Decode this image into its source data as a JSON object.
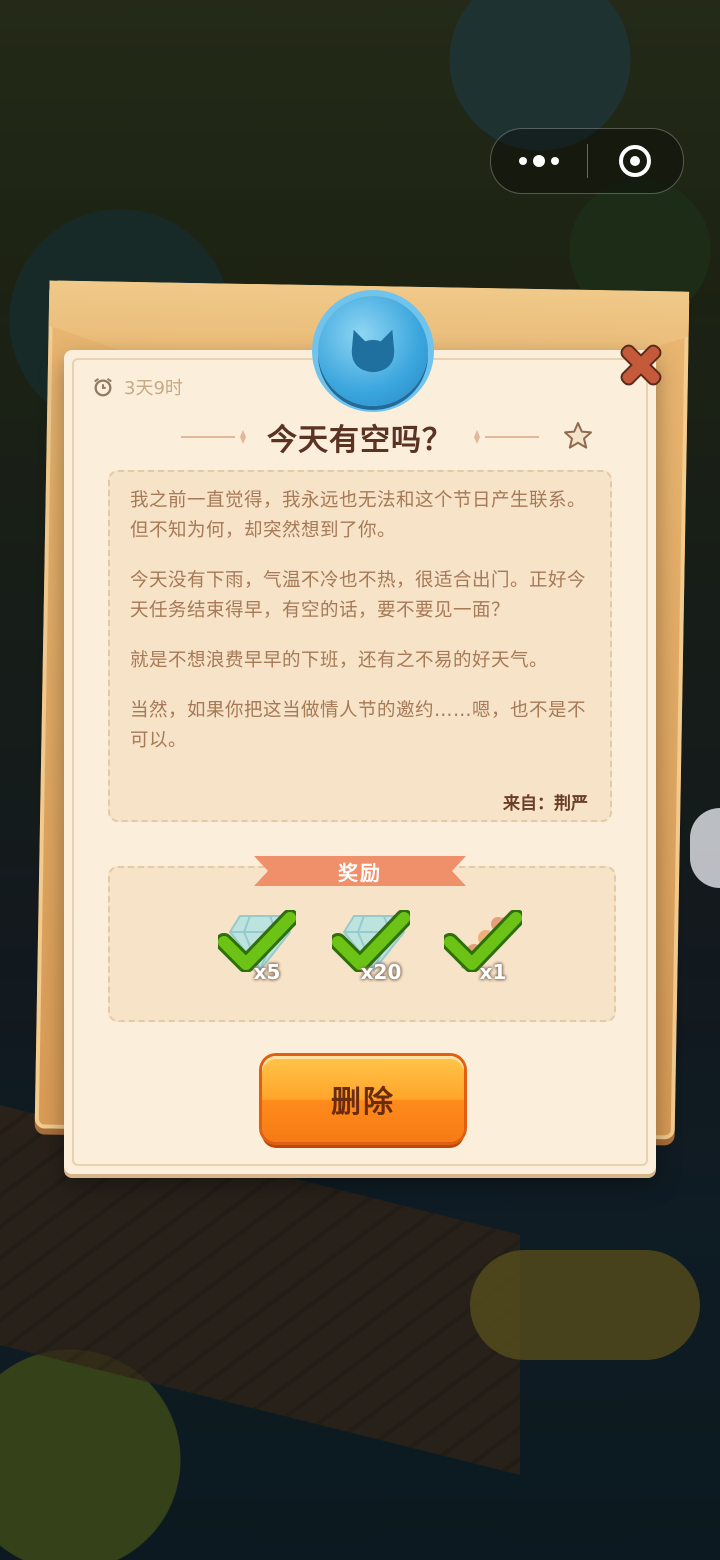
{
  "timer": {
    "text": "3天9时"
  },
  "letter": {
    "title": "今天有空吗？",
    "paragraphs": [
      "我之前一直觉得，我永远也无法和这个节日产生联系。但不知为何，却突然想到了你。",
      "今天没有下雨，气温不冷也不热，很适合出门。正好今天任务结束得早，有空的话，要不要见一面？",
      "就是不想浪费早早的下班，还有之不易的好天气。",
      "当然，如果你把这当做情人节的邀约……嗯，也不是不可以。"
    ],
    "sender_label": "来自：",
    "sender_name": "荆严"
  },
  "rewards": {
    "title": "奖励",
    "items": [
      {
        "icon": "diamond-icon",
        "count": "x5",
        "claimed": true
      },
      {
        "icon": "diamond-icon",
        "count": "x20",
        "claimed": true
      },
      {
        "icon": "food-skewer-icon",
        "count": "x1",
        "claimed": true
      }
    ]
  },
  "actions": {
    "delete_label": "删除"
  },
  "colors": {
    "title_text": "#5a3322",
    "body_text": "#a67a56",
    "seal_blue": "#3aa5dd",
    "button_orange": "#ffa52a",
    "banner_salmon": "#f0906a",
    "check_green": "#6cc316"
  }
}
